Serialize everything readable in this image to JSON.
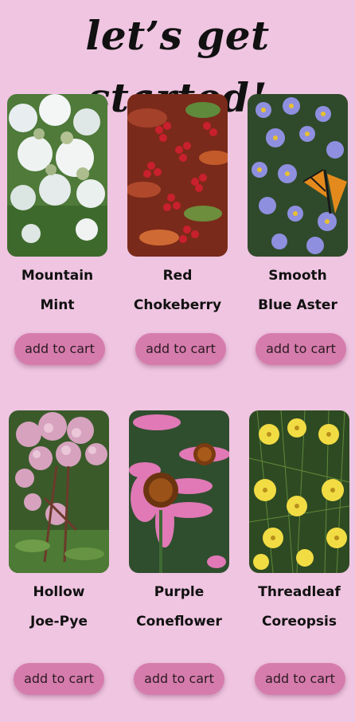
{
  "header": {
    "title": "let’s get started!"
  },
  "products": [
    {
      "name_line1": "Mountain",
      "name_line2": "Mint",
      "button_label": "add to cart",
      "image": "mountain-mint-photo"
    },
    {
      "name_line1": "Red",
      "name_line2": "Chokeberry",
      "button_label": "add to cart",
      "image": "red-chokeberry-photo"
    },
    {
      "name_line1": "Smooth",
      "name_line2": "Blue Aster",
      "button_label": "add to cart",
      "image": "smooth-blue-aster-photo"
    },
    {
      "name_line1": "Hollow",
      "name_line2": "Joe-Pye",
      "button_label": "add to cart",
      "image": "hollow-joe-pye-photo"
    },
    {
      "name_line1": "Purple",
      "name_line2": "Coneflower",
      "button_label": "add to cart",
      "image": "purple-coneflower-photo"
    },
    {
      "name_line1": "Threadleaf",
      "name_line2": "Coreopsis",
      "button_label": "add to cart",
      "image": "threadleaf-coreopsis-photo"
    }
  ],
  "colors": {
    "background": "#efc5e1",
    "button": "#d67cad",
    "text": "#111111"
  }
}
